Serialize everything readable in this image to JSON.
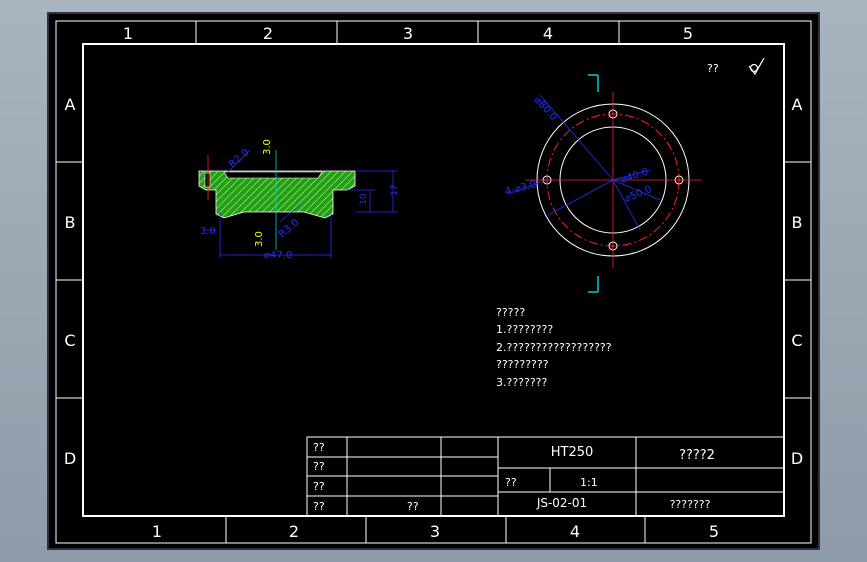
{
  "colors": {
    "background": "#000000",
    "frame": "#ffffff",
    "section_fill": "#1f9e1f",
    "section_hatch": "#8bd33a",
    "dimension": "#2030ff",
    "centerline": "#ff2020",
    "leader": "#00d0d0",
    "marker": "#ffff00"
  },
  "border": {
    "top_columns": [
      "1",
      "2",
      "3",
      "4",
      "5"
    ],
    "bottom_columns": [
      "1",
      "2",
      "3",
      "4",
      "5"
    ],
    "left_rows": [
      "A",
      "B",
      "C",
      "D"
    ],
    "right_rows": [
      "A",
      "B",
      "C",
      "D"
    ]
  },
  "roughness": {
    "label": "??",
    "symbol": "√"
  },
  "section_view": {
    "dims": {
      "r2": "R2.0",
      "top3": "3.0",
      "left3": "3.0",
      "bottom3": "3.0",
      "r3": "R3.0",
      "dia47": "⌀47.0",
      "h10": "10",
      "h17": "17"
    }
  },
  "top_view": {
    "dims": {
      "d80": "⌀80.0",
      "d40": "⌀40.0",
      "d50": "⌀50.0",
      "holes": "4-⌀3.0"
    }
  },
  "notes": {
    "title": "?????",
    "lines": [
      "1.????????",
      "2.??????????????????",
      "?????????",
      "3.???????"
    ]
  },
  "title_block": {
    "row_labels": [
      "??",
      "??",
      "??",
      "??"
    ],
    "mid_label": "??",
    "material": "HT250",
    "part_name": "????2",
    "scale_label": "??",
    "scale_value": "1:1",
    "drawing_no": "JS-02-01",
    "company": "???????"
  }
}
